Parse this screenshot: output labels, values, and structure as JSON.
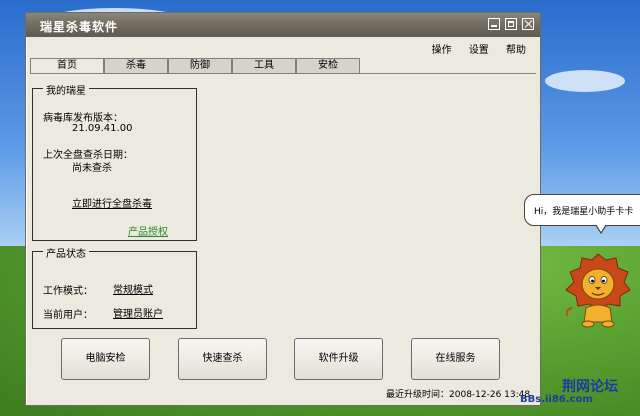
{
  "window": {
    "title": "瑞星杀毒软件"
  },
  "menu": [
    "操作",
    "设置",
    "帮助"
  ],
  "tabs": [
    "首页",
    "杀毒",
    "防御",
    "工具",
    "安检"
  ],
  "my_rising": {
    "legend": "我的瑞星",
    "virus_db_label": "病毒库发布版本：",
    "virus_db_value": "21.09.41.00",
    "last_scan_label": "上次全盘查杀日期：",
    "last_scan_value": "尚未查杀",
    "scan_now_link": "立即进行全盘杀毒",
    "license_link": "产品授权"
  },
  "product_status": {
    "legend": "产品状态",
    "work_mode_label": "工作模式：",
    "work_mode_value": "常规模式",
    "user_label": "当前用户：",
    "user_value": "管理员账户"
  },
  "buttons": [
    "电脑安检",
    "快速查杀",
    "软件升级",
    "在线服务"
  ],
  "status": {
    "last_update_label": "最近升级时间：",
    "last_update_value": "2008-12-26 13:48"
  },
  "assistant": {
    "bubble_text": "Hi，我是瑞星小助手卡卡"
  },
  "watermark": {
    "line1": "荆网论坛",
    "line2": "BBs.ii86.com"
  },
  "colors": {
    "titlebar": "#6e6a5e",
    "window_bg": "#eceadf",
    "link_green": "#2f8a2f"
  }
}
